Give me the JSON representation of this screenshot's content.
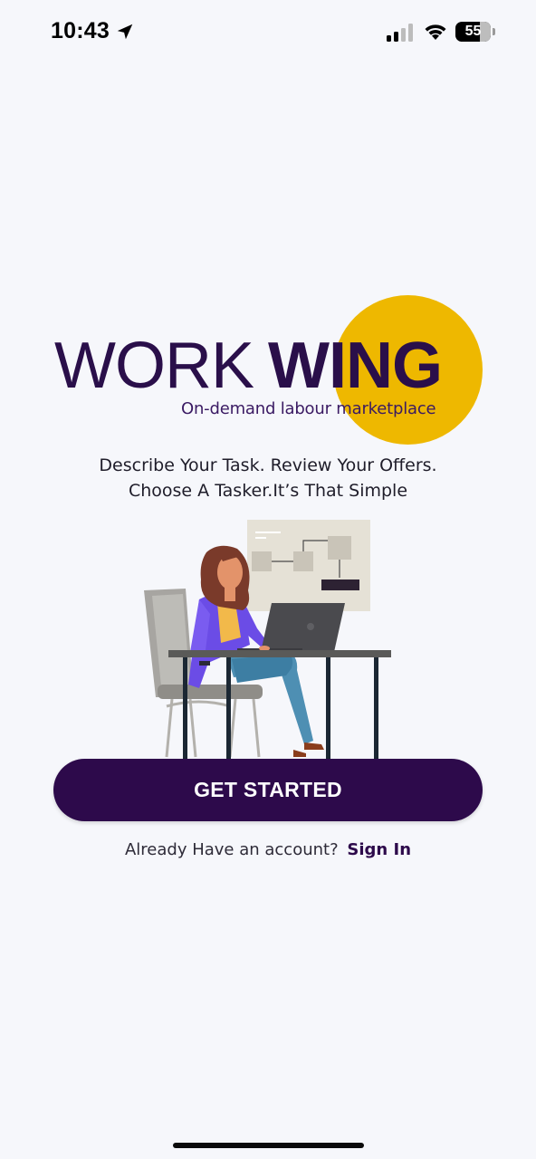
{
  "status_bar": {
    "time": "10:43",
    "battery": "55",
    "icons": [
      "location-arrow-icon",
      "cellular-signal-icon",
      "wifi-icon",
      "battery-icon"
    ]
  },
  "logo": {
    "word_light": "WORK",
    "word_bold": "WING",
    "tagline": "On-demand labour marketplace",
    "colors": {
      "accent_circle": "#eeb800",
      "text": "#2a0f4a"
    }
  },
  "description": {
    "line1": "Describe Your Task. Review Your Offers.",
    "line2": "Choose A Tasker.It’s That Simple"
  },
  "cta": {
    "label": "GET STARTED",
    "color": "#2d0a4b"
  },
  "signin": {
    "prompt": "Already Have an account?",
    "link": "Sign In"
  }
}
